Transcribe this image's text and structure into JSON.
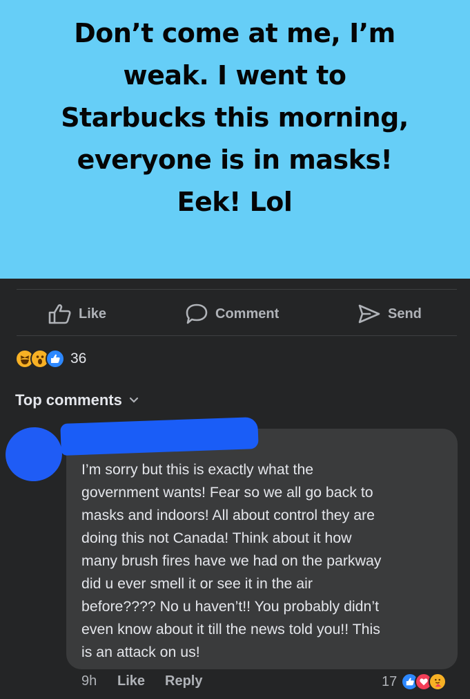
{
  "post": {
    "lines": [
      "Don’t come at me, I’m",
      "weak. I went to",
      "Starbucks this morning,",
      "everyone is in masks!",
      "Eek! Lol"
    ],
    "background": "#66cef7"
  },
  "actions": {
    "like": "Like",
    "comment": "Comment",
    "send": "Send"
  },
  "reactions": {
    "icons": [
      "haha-icon",
      "wow-icon",
      "like-icon"
    ],
    "count": "36"
  },
  "comments_header": "Top comments",
  "comment": {
    "text": "I’m sorry but this is exactly what the government wants! Fear so we all go back to masks and indoors! All about control they are doing this not Canada! Think about it how many brush fires have we had on the parkway did u ever smell it or see it in the air before???? No u haven’t!! You probably didn’t even know about it till the news told you!! This is an attack on us!",
    "lines": [
      "I’m sorry but this is exactly what the",
      "government wants! Fear so we all go back to",
      "masks and indoors! All about control they are",
      "doing this not Canada! Think about it how",
      "many brush fires have we had on the parkway",
      "did u ever smell it or see it in the air",
      "before???? No u haven’t!! You probably didn’t",
      "even know about it till the news told you!! This",
      "is an attack on us!"
    ],
    "time": "9h",
    "like": "Like",
    "reply": "Reply",
    "reaction_count": "17",
    "reaction_icons": [
      "like-icon",
      "love-icon",
      "care-icon"
    ]
  },
  "colors": {
    "dark_bg": "#242526",
    "bubble": "#3a3b3c",
    "text": "#e4e6eb",
    "muted": "#b0b3b8",
    "like_blue": "#2d88ff",
    "love_red": "#f33e58",
    "haha_yellow": "#f7b125"
  }
}
